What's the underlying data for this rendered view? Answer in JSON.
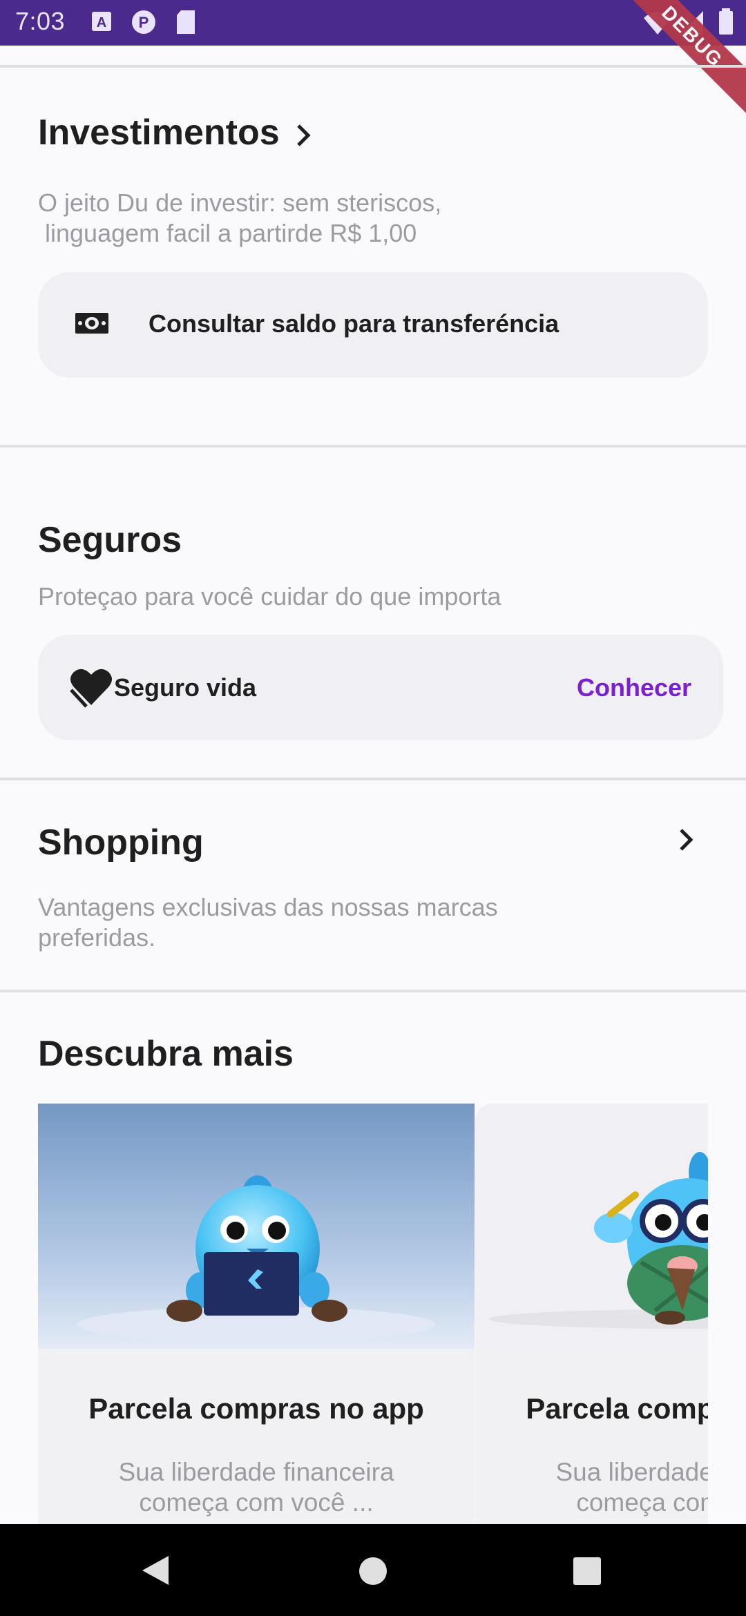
{
  "status_bar": {
    "time": "7:03",
    "debug_label": "DEBUG",
    "icons": [
      "a-notification-icon",
      "p-notification-icon",
      "sd-card-icon",
      "wifi-icon",
      "signal-icon",
      "battery-icon"
    ]
  },
  "investimentos": {
    "title": "Investimentos",
    "subtitle_line1": "O jeito Du de investir: sem steriscos,",
    "subtitle_line2": " linguagem facil a partirde R$ 1,00",
    "card_label": "Consultar saldo para transferéncia",
    "card_icon": "money-icon"
  },
  "seguros": {
    "title": "Seguros",
    "subtitle": "Proteçao para você cuidar do que importa",
    "card_label": "Seguro vida",
    "card_icon": "heart-icon",
    "action_label": "Conhecer",
    "accent_color": "#7a1fd1"
  },
  "shopping": {
    "title": "Shopping",
    "subtitle_line1": "Vantagens exclusivas das nossas marcas",
    "subtitle_line2": "preferidas."
  },
  "descubra": {
    "title": "Descubra mais",
    "cards": [
      {
        "title": "Parcela compras no app",
        "desc_line1": "Sua liberdade financeira",
        "desc_line2": "começa com você ..."
      },
      {
        "title": "Parcela compras no app",
        "desc_line1": "Sua liberdade financeira",
        "desc_line2": "começa com você ..."
      }
    ]
  },
  "colors": {
    "status_bar": "#4a2a8c",
    "background": "#fafafc",
    "card": "#f0f0f4"
  }
}
